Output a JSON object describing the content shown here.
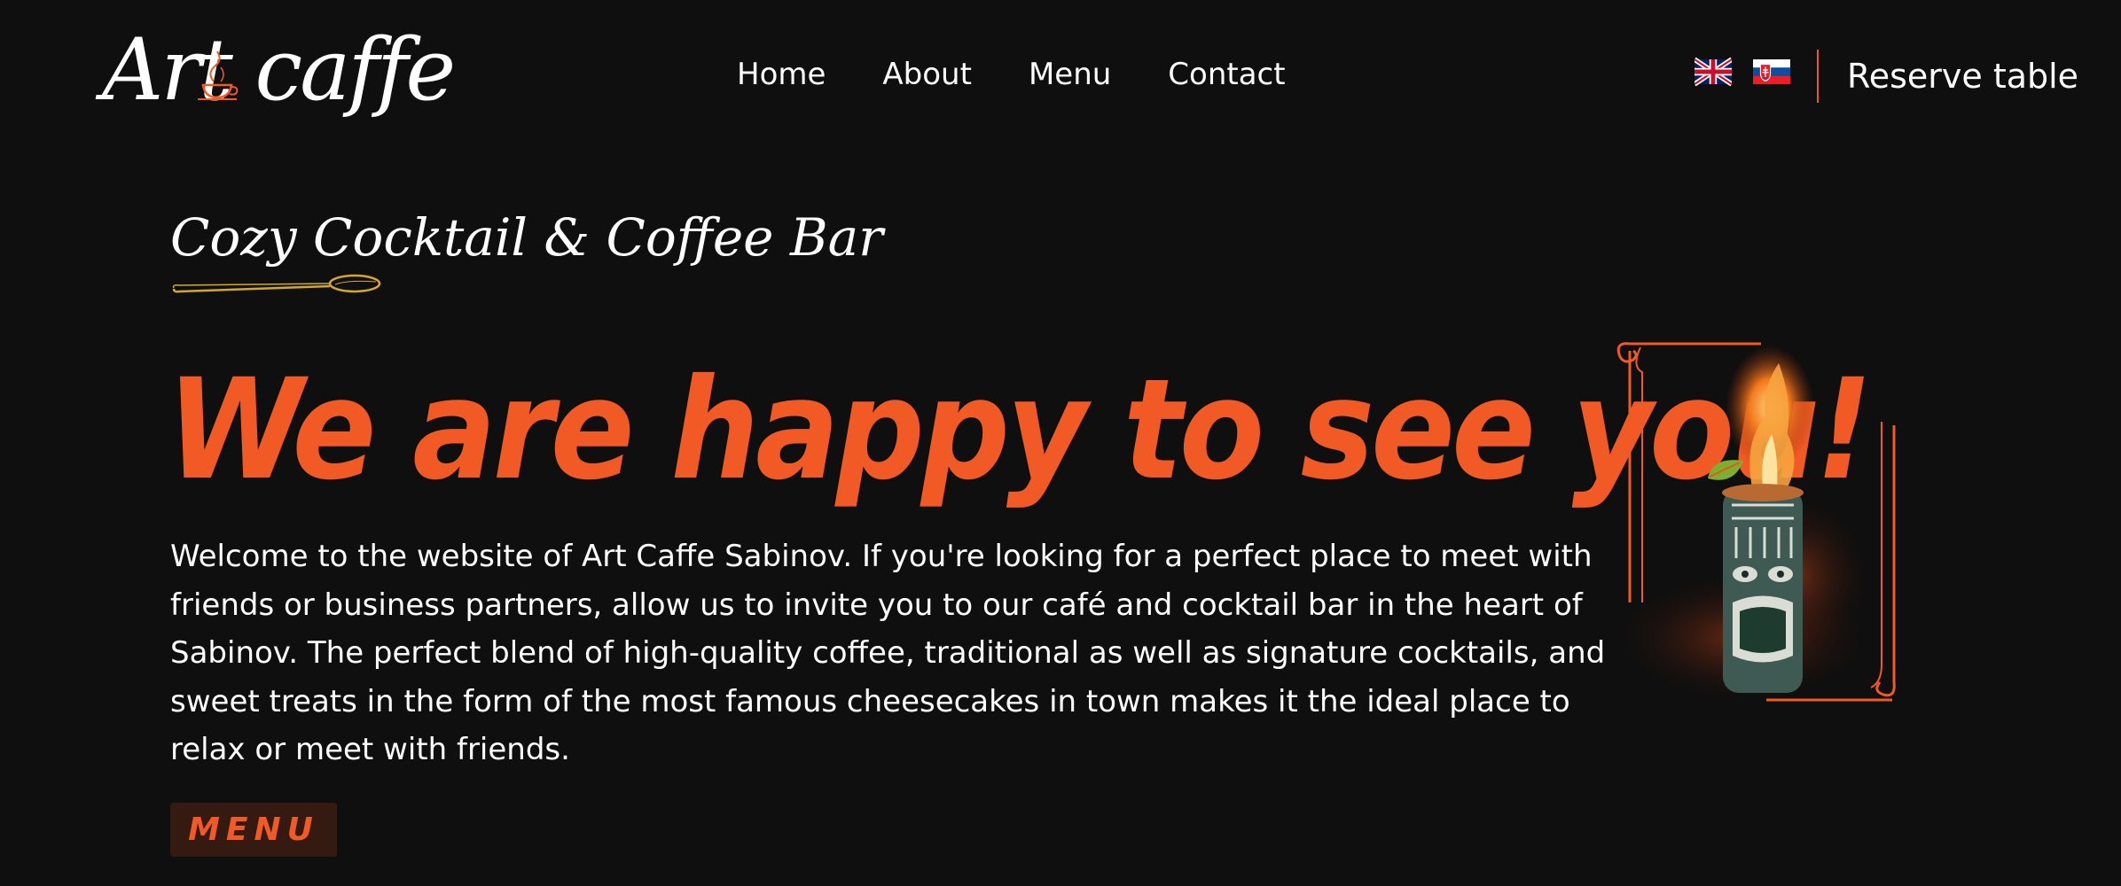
{
  "header": {
    "logo_text": "Art caffe",
    "nav": [
      {
        "label": "Home"
      },
      {
        "label": "About"
      },
      {
        "label": "Menu"
      },
      {
        "label": "Contact"
      }
    ],
    "languages": [
      {
        "icon": "uk-flag-icon"
      },
      {
        "icon": "slovakia-flag-icon"
      }
    ],
    "reserve_label": "Reserve table"
  },
  "hero": {
    "subtitle": "Cozy Cocktail & Coffee Bar",
    "headline": "We are happy to see you!",
    "intro": "Welcome to the website of Art Caffe Sabinov. If you're looking for a perfect place to meet with friends or business partners, allow us to invite you to our café and cocktail bar in the heart of Sabinov. The perfect blend of high-quality coffee, traditional as well as signature cocktails, and sweet treats in the form of the most famous cheesecakes in town makes it the ideal place to relax or meet with friends.",
    "menu_button": "MENU",
    "image_icon": "flaming-tiki-cocktail-image"
  },
  "colors": {
    "background": "#0f0f0f",
    "accent": "#f15a24",
    "button_bg": "#351a12",
    "text": "#ffffff",
    "spoon": "#d4a92a"
  }
}
